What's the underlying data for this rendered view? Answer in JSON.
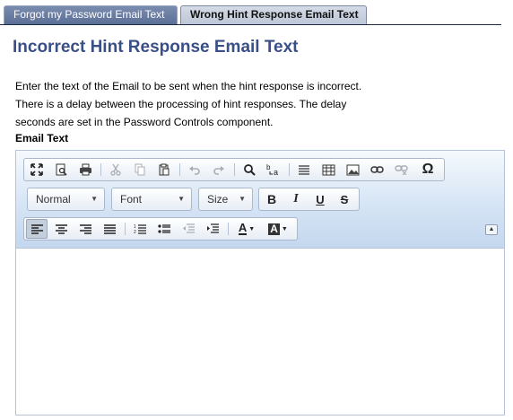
{
  "tabs": [
    {
      "label": "Forgot my Password Email Text",
      "active": false
    },
    {
      "label": "Wrong Hint Response Email Text",
      "active": true
    }
  ],
  "page_title": "Incorrect Hint Response Email Text",
  "description": [
    "Enter the text of the Email to be sent when the hint response is incorrect.",
    "There is a delay between the processing of hint responses. The delay",
    "seconds are set in the Password Controls component."
  ],
  "email_label": "Email Text",
  "editor": {
    "format_combo": "Normal",
    "font_combo": "Font",
    "size_combo": "Size",
    "bold": "B",
    "italic": "I",
    "underline": "U",
    "strike": "S",
    "text_color": "A",
    "bg_color": "A",
    "special_char": "Ω",
    "body": ""
  }
}
